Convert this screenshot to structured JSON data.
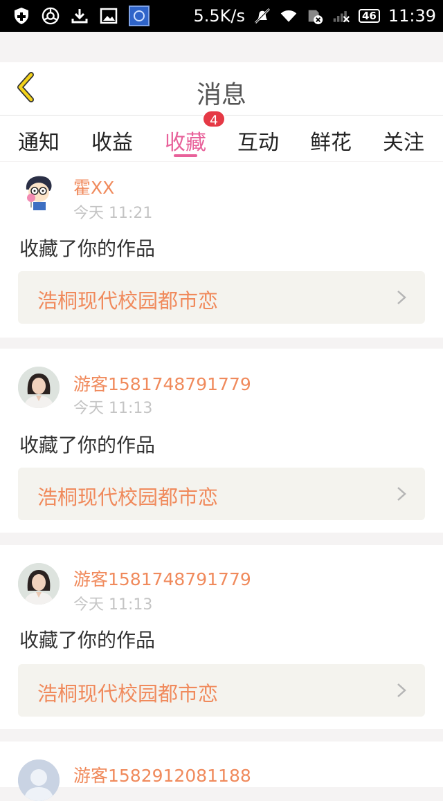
{
  "status_bar": {
    "net_speed": "5.5K/s",
    "battery_label": "46",
    "clock": "11:39",
    "left_icons": [
      "shield-plus-icon",
      "browser-icon",
      "download-icon",
      "image-icon",
      "app-icon"
    ],
    "right_icons": [
      "mute-icon",
      "wifi-icon",
      "sim-icon",
      "signal-icon"
    ]
  },
  "header": {
    "title": "消息",
    "back_icon": "chevron-left-icon"
  },
  "tabs": {
    "items": [
      {
        "label": "通知"
      },
      {
        "label": "收益"
      },
      {
        "label": "收藏",
        "active": true
      },
      {
        "label": "互动"
      },
      {
        "label": "鲜花"
      },
      {
        "label": "关注"
      }
    ],
    "badge": "4"
  },
  "messages": [
    {
      "user": "霍XX",
      "time": "今天 11:21",
      "action": "收藏了你的作品",
      "work_title": "浩桐现代校园都市恋",
      "avatar": "cartoon-avatar"
    },
    {
      "user": "游客1581748791779",
      "time": "今天 11:13",
      "action": "收藏了你的作品",
      "work_title": "浩桐现代校园都市恋",
      "avatar": "photo-avatar"
    },
    {
      "user": "游客1581748791779",
      "time": "今天 11:13",
      "action": "收藏了你的作品",
      "work_title": "浩桐现代校园都市恋",
      "avatar": "photo-avatar"
    },
    {
      "user": "游客1582912081188",
      "avatar": "default-avatar"
    }
  ],
  "colors": {
    "accent_pink": "#e8619a",
    "name_orange": "#f08a5c",
    "badge_red": "#e53945",
    "back_yellow": "#f3d21a"
  }
}
